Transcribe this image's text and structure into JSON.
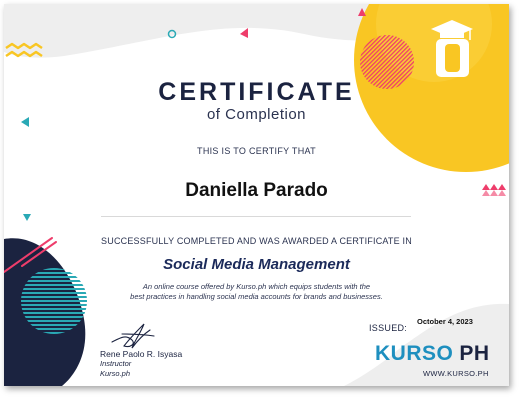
{
  "certificate": {
    "title": "CERTIFICATE",
    "subtitle": "of Completion",
    "certify_text": "THIS IS TO CERTIFY THAT",
    "recipient_name": "Daniella Parado",
    "completed_text": "SUCCESSFULLY COMPLETED AND WAS AWARDED A CERTIFICATE IN",
    "course_name": "Social Media Management",
    "description_line1": "An online course offered by Kurso.ph which equips students with the",
    "description_line2": "best practices in handling social media accounts for brands and businesses."
  },
  "instructor": {
    "name": "Rene Paolo R. Isyasa",
    "role": "Instructor",
    "organization": "Kurso.ph"
  },
  "issued": {
    "label": "ISSUED:",
    "date": "October 4, 2023"
  },
  "brand": {
    "logo_main": "KURSO",
    "logo_suffix": "PH",
    "website": "WWW.KURSO.PH"
  },
  "colors": {
    "navy": "#1b2340",
    "yellow": "#f9c623",
    "pink": "#ee3d6b",
    "teal": "#2aa9b5",
    "blue": "#1e8fbf"
  }
}
